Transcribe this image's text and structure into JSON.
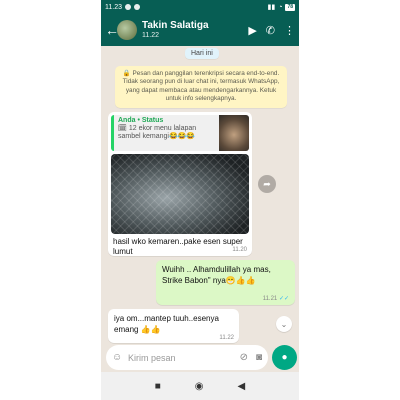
{
  "status_bar": {
    "time": "11.23",
    "battery": "78"
  },
  "header": {
    "contact_name": "Takin Salatiga",
    "last_seen": "11.22"
  },
  "chat": {
    "date_chip": "Hari ini",
    "encryption_note": "🔒 Pesan dan panggilan terenkripsi secara end-to-end. Tidak seorang pun di luar chat ini, termasuk WhatsApp, yang dapat membaca atau mendengarkannya. Ketuk untuk info selengkapnya.",
    "messages": [
      {
        "direction": "incoming",
        "quoted_author": "Anda • Status",
        "quoted_text": "🗓 12 ekor menu lalapan sambel kemangi😂😂😂",
        "caption": "hasil wko kemaren..pake esen super lumut",
        "time": "11.20"
      },
      {
        "direction": "outgoing",
        "text": "Wuihh .. Alhamdulillah ya mas, Strike Babon\" nya😁👍👍",
        "time": "11.21",
        "ticks": "✓✓"
      },
      {
        "direction": "incoming",
        "text": "iya om...mantep tuuh..esenya emang 👍👍",
        "time": "11.22"
      }
    ]
  },
  "input": {
    "placeholder": "Kirim pesan"
  },
  "icons": {
    "back": "arrow-left-icon",
    "video": "video-call-icon",
    "call": "phone-icon",
    "menu": "more-vert-icon",
    "emoji": "emoji-icon",
    "attach": "attach-icon",
    "camera": "camera-icon",
    "mic": "mic-icon"
  },
  "colors": {
    "header": "#075e54",
    "chat_background": "#ece5dd",
    "outgoing_bubble": "#dcf8c6",
    "mic_button": "#00a884"
  }
}
